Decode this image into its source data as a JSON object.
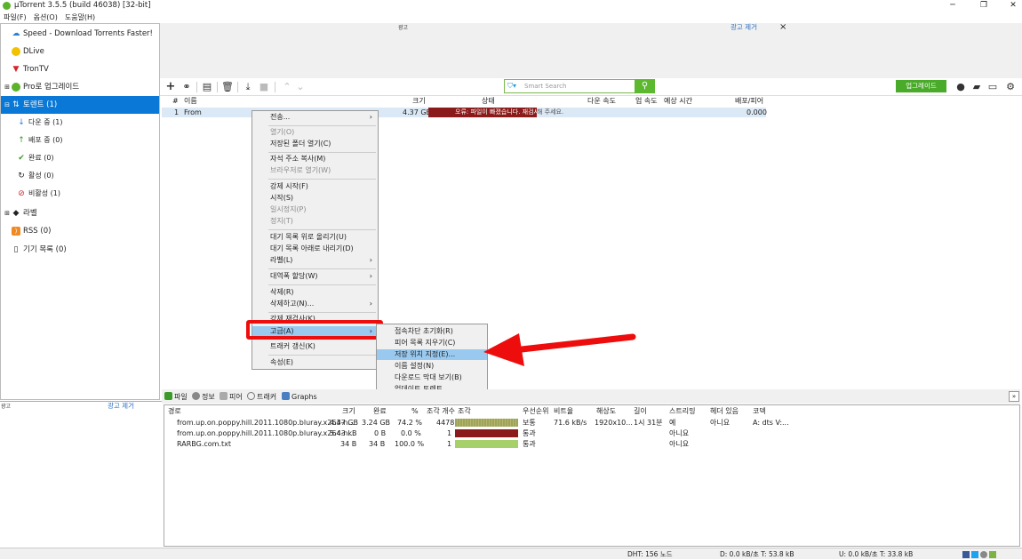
{
  "window": {
    "title": "µTorrent 3.5.5  (build 46038) [32-bit]"
  },
  "menu": [
    "파일(F)",
    "옵션(O)",
    "도움말(H)"
  ],
  "sidebar": {
    "items": [
      {
        "label": "Speed - Download Torrents Faster!"
      },
      {
        "label": "DLive"
      },
      {
        "label": "TronTV"
      },
      {
        "label": "Pro로 업그레이드"
      },
      {
        "label": "토렌트 (1)"
      },
      {
        "label": "다운 중 (1)"
      },
      {
        "label": "배포 중 (0)"
      },
      {
        "label": "완료 (0)"
      },
      {
        "label": "활성 (0)"
      },
      {
        "label": "비활성 (1)"
      },
      {
        "label": "라벨"
      },
      {
        "label": "RSS (0)"
      },
      {
        "label": "기기 목록 (0)"
      }
    ]
  },
  "ad": {
    "label": "광고",
    "remove": "광고 제거",
    "close": "×"
  },
  "toolbar": {
    "search_placeholder": "Smart Search",
    "upgrade": "업그레이드"
  },
  "torrent_list": {
    "headers": [
      "#",
      "이름",
      "크기",
      "상태",
      "다운 속도",
      "업 속도",
      "예상 시간",
      "배포/피어"
    ],
    "rows": [
      {
        "num": "1",
        "name": "From",
        "size": "4.37 GB",
        "status": "오류: 파일이 빠졌습니다. 재검사를",
        "status_tail": "해 주세요.",
        "ratio": "0.000"
      }
    ]
  },
  "context_menu": {
    "items": [
      {
        "label": "전송..."
      },
      {
        "label": "열기(O)"
      },
      {
        "label": "저장된 폴더 열기(C)"
      },
      {
        "label": "자석 주소 복사(M)"
      },
      {
        "label": "브라우저로 열기(W)"
      },
      {
        "label": "강제 시작(F)"
      },
      {
        "label": "시작(S)"
      },
      {
        "label": "일시정지(P)"
      },
      {
        "label": "정지(T)"
      },
      {
        "label": "대기 목록 위로 올리기(U)"
      },
      {
        "label": "대기 목록 아래로 내리기(D)"
      },
      {
        "label": "라벨(L)"
      },
      {
        "label": "대역폭 할당(W)"
      },
      {
        "label": "삭제(R)"
      },
      {
        "label": "삭제하고(N)..."
      },
      {
        "label": "강제 재검사(K)"
      },
      {
        "label": "고급(A)"
      },
      {
        "label": "트래커 갱신(K)"
      },
      {
        "label": "속성(E)"
      }
    ]
  },
  "submenu": {
    "items": [
      {
        "label": "접속차단 초기화(R)"
      },
      {
        "label": "피어 목록 지우기(C)"
      },
      {
        "label": "저장 위치 지정(E)..."
      },
      {
        "label": "이름 설정(N)"
      },
      {
        "label": "다운로드 막대 보기(B)"
      },
      {
        "label": "업데이트 토렌트..."
      }
    ]
  },
  "tabs": [
    "파일",
    "정보",
    "피어",
    "트래커",
    "Graphs"
  ],
  "files": {
    "headers": [
      "경로",
      "크기",
      "완료",
      "%",
      "조각 개수",
      "조각",
      "우선순위",
      "비트율",
      "해상도",
      "길이",
      "스트리밍",
      "헤더 있음",
      "코덱"
    ],
    "rows": [
      {
        "path": "from.up.on.poppy.hill.2011.1080p.bluray.x264-n...",
        "size": "4.37 GB",
        "done": "3.24 GB",
        "pct": "74.2 %",
        "pieces": "4478",
        "priority": "보통",
        "bitrate": "71.6 kB/s",
        "res": "1920x10...",
        "len": "1시 31분",
        "stream": "예",
        "header": "아니요",
        "codec": "A: dts V:..."
      },
      {
        "path": "from.up.on.poppy.hill.2011.1080p.bluray.x264-n...",
        "size": "5.43 kB",
        "done": "0 B",
        "pct": "0.0 %",
        "pieces": "1",
        "priority": "통과",
        "bitrate": "",
        "res": "",
        "len": "",
        "stream": "아니요",
        "header": "",
        "codec": ""
      },
      {
        "path": "RARBG.com.txt",
        "size": "34 B",
        "done": "34 B",
        "pct": "100.0 %",
        "pieces": "1",
        "priority": "통과",
        "bitrate": "",
        "res": "",
        "len": "",
        "stream": "아니요",
        "header": "",
        "codec": ""
      }
    ]
  },
  "statusbar": {
    "dht": "DHT: 156 노드",
    "down": "D: 0.0 kB/초 T: 53.8 kB",
    "up": "U: 0.0 kB/초 T: 33.8 kB"
  },
  "colors": {
    "accent": "#0a78d7",
    "green": "#5cb82e",
    "error": "#8b1a1a",
    "highlight": "#ee0d0d"
  }
}
